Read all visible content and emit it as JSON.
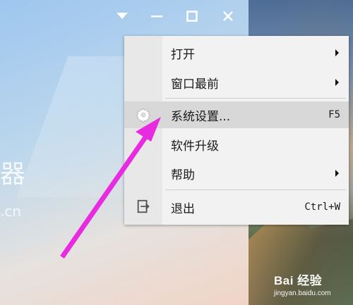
{
  "menu": {
    "items": [
      {
        "label": "打开",
        "submenu": true
      },
      {
        "label": "窗口最前",
        "submenu": true
      },
      {
        "label": "系统设置...",
        "shortcut": "F5",
        "highlighted": true,
        "icon": "gear-icon"
      },
      {
        "label": "软件升级"
      },
      {
        "label": "帮助",
        "submenu": true
      },
      {
        "label": "退出",
        "shortcut": "Ctrl+W",
        "icon": "exit-icon"
      }
    ]
  },
  "window_controls": [
    "dropdown-icon",
    "minimize-icon",
    "maximize-icon",
    "close-icon"
  ],
  "background_text": {
    "title": "器",
    "sub": ".cn"
  },
  "watermark": {
    "main": "Bai 经验",
    "sub": "jingyan.baidu.com"
  },
  "colors": {
    "annotation_arrow": "#e82be0",
    "menu_bg": "#f2f2f2",
    "menu_highlight": "#d8d8d8"
  }
}
